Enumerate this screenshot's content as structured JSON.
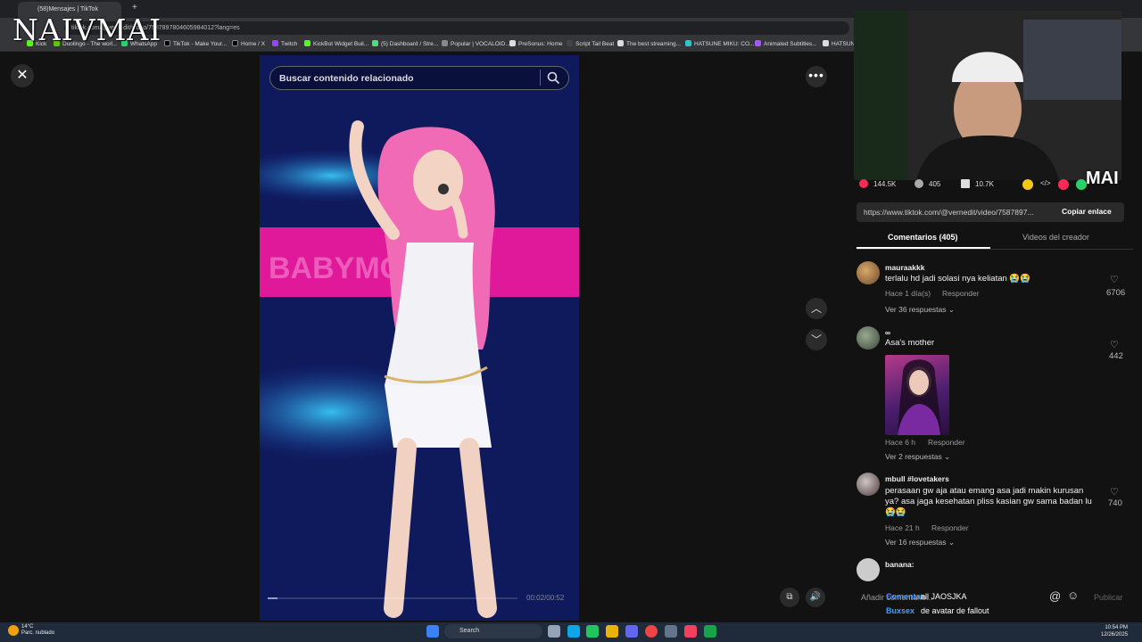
{
  "overlay": {
    "logo_text": "NAIVMAI",
    "corner_badge": "MAI"
  },
  "browser": {
    "tab_title": "(58)Mensajes | TikTok",
    "address": "tiktok.com/@vernedit/video/7587897804605984012?lang=es",
    "bookmarks": [
      "Kick",
      "Duolingo - The worl...",
      "WhatsApp",
      "TikTok - Make Your...",
      "Home / X",
      "Twitch",
      "KickBot Widget Buil...",
      "(5) Dashboard / Stre...",
      "Popular | VOCALOID...",
      "PreSonus: Home",
      "Script Tail Beat",
      "The best streaming...",
      "HATSUNE MIKU: CO...",
      "Animated Subtitles...",
      "HATSUN"
    ]
  },
  "viewer": {
    "search_placeholder": "Buscar contenido relacionado",
    "close_icon": "close-icon",
    "time": "00:02/00:52",
    "progress": 0.04,
    "banner_text": "BABYMON"
  },
  "stats": {
    "likes": "144.5K",
    "comments": "405",
    "saves": "10.7K"
  },
  "link": {
    "url": "https://www.tiktok.com/@vernedit/video/7587897...",
    "copy_label": "Copiar enlace"
  },
  "tabs": {
    "comments": "Comentarios (405)",
    "creator": "Videos del creador"
  },
  "comments": [
    {
      "user": "mauraakkk",
      "text": "terlalu hd jadi solasi nya keliatan 😭😭",
      "time": "Hace 1 día(s)",
      "reply": "Responder",
      "replies": "Ver 36 respuestas",
      "likes": "6706"
    },
    {
      "user": "∞",
      "text": "Asa's mother",
      "time": "Hace 6 h",
      "reply": "Responder",
      "replies": "Ver 2 respuestas",
      "likes": "442"
    },
    {
      "user": "mbull #lovetakers",
      "text": "perasaan gw aja atau emang asa jadi makin kurusan ya? asa jaga kesehatan pliss kasian gw sama badan lu 😭😭",
      "time": "Hace 21 h",
      "reply": "Responder",
      "replies": "Ver 16 respuestas",
      "likes": "740"
    },
    {
      "user": "banana:"
    }
  ],
  "comment_input": {
    "placeholder": "Añadir comentario...",
    "chat_user1": "Comentar",
    "chat_msg1": "all JAOSJKA",
    "chat_user2": "Buxsex",
    "chat_msg2": "de avatar de fallout",
    "publish": "Publicar"
  },
  "taskbar": {
    "search": "Search",
    "weather_temp": "14°C",
    "weather_desc": "Parc. nublado",
    "time": "10:54 PM",
    "date": "12/26/2025"
  }
}
